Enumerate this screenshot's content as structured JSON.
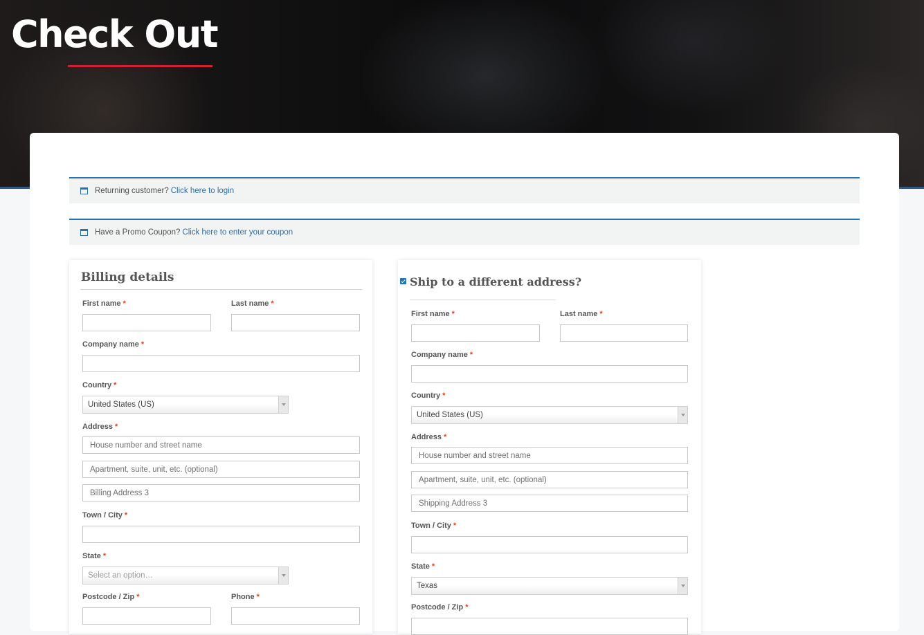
{
  "page": {
    "title": "Check Out"
  },
  "notices": {
    "returning": {
      "text": "Returning customer?",
      "link": "Click here to login",
      "icon": "window-icon"
    },
    "coupon": {
      "text": "Have a Promo Coupon?",
      "link": "Click here to enter your coupon",
      "icon": "window-icon"
    }
  },
  "billing": {
    "title": "Billing details",
    "first_name": "First name",
    "last_name": "Last name",
    "company": "Company name",
    "country": "Country",
    "country_value": "United States (US)",
    "address": "Address",
    "address1_placeholder": "House number and street name",
    "address2_placeholder": "Apartment, suite, unit, etc. (optional)",
    "address3_placeholder": "Billing Address 3",
    "city": "Town / City",
    "state": "State",
    "state_placeholder": "Select an option…",
    "postcode": "Postcode / Zip",
    "phone": "Phone"
  },
  "shipping": {
    "title": "Ship to a different address?",
    "checked": true,
    "first_name": "First name",
    "last_name": "Last name",
    "company": "Company name",
    "country": "Country",
    "country_value": "United States (US)",
    "address": "Address",
    "address1_placeholder": "House number and street name",
    "address2_placeholder": "Apartment, suite, unit, etc. (optional)",
    "address3_placeholder": "Shipping Address 3",
    "city": "Town / City",
    "state": "State",
    "state_value": "Texas",
    "postcode": "Postcode / Zip"
  },
  "required_mark": "*",
  "colors": {
    "accent_blue": "#2374b4",
    "title_underline": "#d1222b",
    "required": "#e2401c"
  }
}
